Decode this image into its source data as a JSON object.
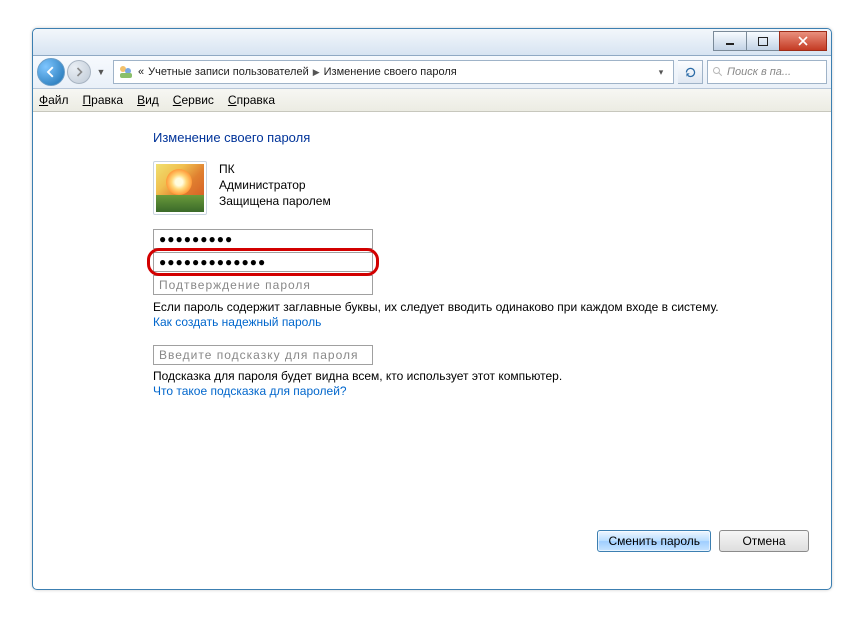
{
  "breadcrumb": {
    "prefix": "«",
    "segment1": "Учетные записи пользователей",
    "segment2": "Изменение своего пароля"
  },
  "search": {
    "placeholder": "Поиск в па..."
  },
  "menu": {
    "file": "Файл",
    "edit": "Правка",
    "view": "Вид",
    "tools": "Сервис",
    "help": "Справка"
  },
  "page": {
    "heading": "Изменение своего пароля",
    "user_name": "ПК",
    "user_role": "Администратор",
    "user_status": "Защищена паролем",
    "current_pw_value": "●●●●●●●●●",
    "new_pw_value": "●●●●●●●●●●●●●",
    "confirm_placeholder": "Подтверждение пароля",
    "caps_note": "Если пароль содержит заглавные буквы, их следует вводить одинаково при каждом входе в систему.",
    "strong_pw_link": "Как создать надежный пароль",
    "hint_placeholder": "Введите подсказку для пароля",
    "hint_note": "Подсказка для пароля будет видна всем, кто использует этот компьютер.",
    "hint_link": "Что такое подсказка для паролей?",
    "btn_change": "Сменить пароль",
    "btn_cancel": "Отмена"
  }
}
